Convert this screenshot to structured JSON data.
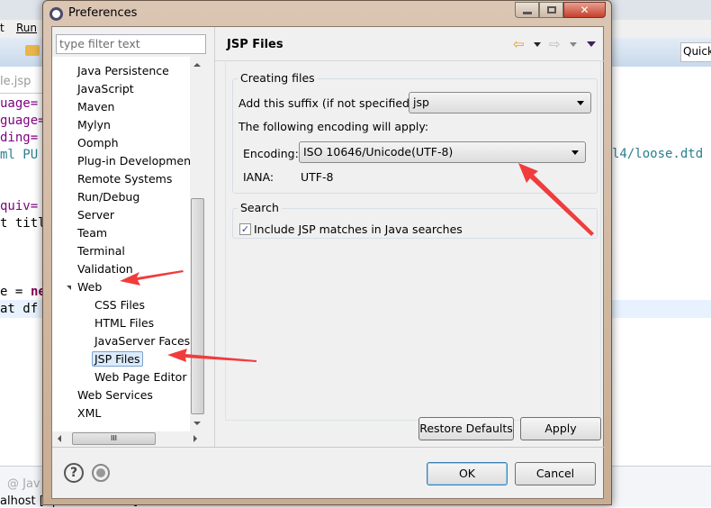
{
  "background": {
    "menu_visible": [
      "t",
      "Run"
    ],
    "editor_tab": "le.jsp",
    "quick_access": "Quick",
    "code_lines": [
      "uage=",
      "guage=",
      "ding=",
      "ml PU",
      "quiv=",
      "t titl",
      "e = ",
      "ne",
      "at df"
    ],
    "code_right": "l4/loose.dtd",
    "console_tab": "@ Jav",
    "console_text": "alhost [Apache Tomcat] ..."
  },
  "dialog": {
    "title": "Preferences",
    "filter_placeholder": "type filter text",
    "tree": [
      {
        "label": "Java Persistence",
        "level": 0,
        "expander": "collapsed"
      },
      {
        "label": "JavaScript",
        "level": 0,
        "expander": "collapsed"
      },
      {
        "label": "Maven",
        "level": 0,
        "expander": "collapsed"
      },
      {
        "label": "Mylyn",
        "level": 0,
        "expander": "collapsed"
      },
      {
        "label": "Oomph",
        "level": 0,
        "expander": "collapsed"
      },
      {
        "label": "Plug-in Development",
        "level": 0,
        "expander": "collapsed"
      },
      {
        "label": "Remote Systems",
        "level": 0,
        "expander": "collapsed"
      },
      {
        "label": "Run/Debug",
        "level": 0,
        "expander": "collapsed"
      },
      {
        "label": "Server",
        "level": 0,
        "expander": "collapsed"
      },
      {
        "label": "Team",
        "level": 0,
        "expander": "collapsed"
      },
      {
        "label": "Terminal",
        "level": 0,
        "expander": "collapsed"
      },
      {
        "label": "Validation",
        "level": 0,
        "expander": "none"
      },
      {
        "label": "Web",
        "level": 0,
        "expander": "expanded"
      },
      {
        "label": "CSS Files",
        "level": 1,
        "expander": "collapsed"
      },
      {
        "label": "HTML Files",
        "level": 1,
        "expander": "collapsed"
      },
      {
        "label": "JavaServer Faces T",
        "level": 1,
        "expander": "collapsed"
      },
      {
        "label": "JSP Files",
        "level": 1,
        "expander": "collapsed",
        "selected": true
      },
      {
        "label": "Web Page Editor",
        "level": 1,
        "expander": "none"
      },
      {
        "label": "Web Services",
        "level": 0,
        "expander": "collapsed"
      },
      {
        "label": "XML",
        "level": 0,
        "expander": "collapsed"
      }
    ],
    "page_title": "JSP Files",
    "creating_files": {
      "title": "Creating files",
      "suffix_label": "Add this suffix (if not specified):",
      "suffix_value": "jsp",
      "encoding_note": "The following encoding will apply:",
      "encoding_label": "Encoding:",
      "encoding_value": "ISO 10646/Unicode(UTF-8)",
      "iana_label": "IANA:",
      "iana_value": "UTF-8"
    },
    "search": {
      "title": "Search",
      "checkbox_label": "Include JSP matches in Java searches",
      "checked": true
    },
    "restore_defaults": "Restore Defaults",
    "apply": "Apply",
    "ok": "OK",
    "cancel": "Cancel",
    "accent_arrow_color": "#f03c3c",
    "selection_color": "#dcebfc"
  }
}
